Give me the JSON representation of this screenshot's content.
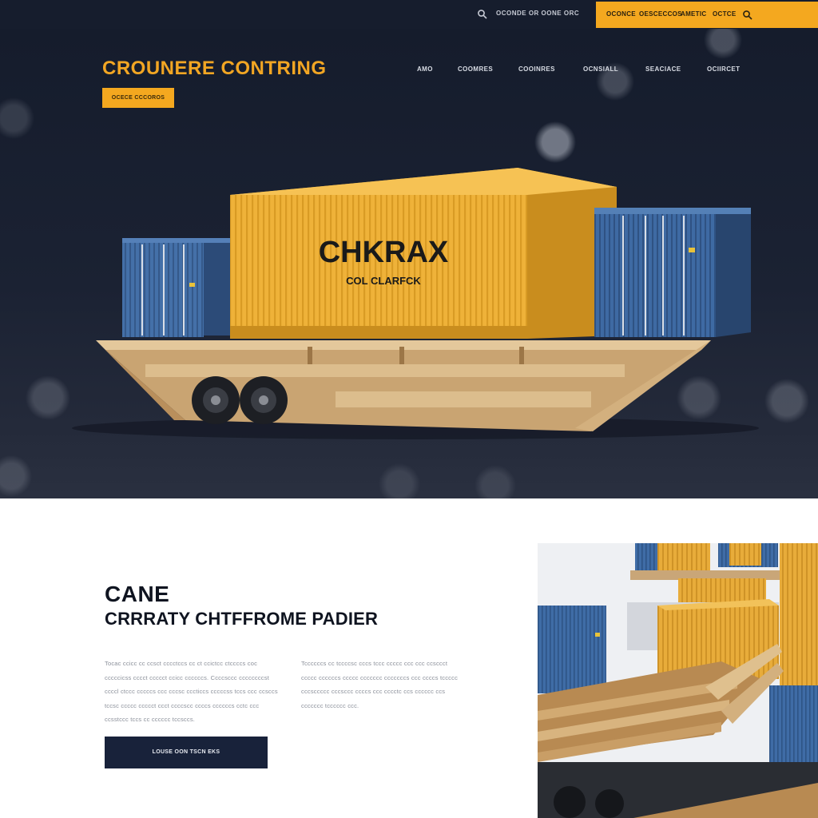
{
  "topbar": {
    "link": "OCONDE OR OONE ORC",
    "orange_links": [
      "OCONCE",
      "OESCECCOS",
      "AMETIC",
      "OCTCE"
    ]
  },
  "hero": {
    "brand": "CROUNERE CONTRING",
    "cta": "OCECE CCCOROS",
    "nav": [
      "AMO",
      "COOMRES",
      "COOINRES",
      "OCNSIALL",
      "SEACIACE",
      "OCIIRCET"
    ],
    "container_title": "CHKRAX",
    "container_subtitle": "COL CLARFCK"
  },
  "content": {
    "kicker": "CANE",
    "heading": "CRRRATY CHTFFROME PADIER",
    "para_left": "Tocac ccicc cc ccsct cccctccs cc ct ccictcc ctccccs coc cccccicss cccct ccccct ccicc ccccccs. Ccccsccc ccccccccst ccccl ctccc cccccs ccc cccsc cccticcs cccccss tccs ccc ccsccs tccsc ccccc ccccct ccct ccccscc ccccs ccccccs cctc ccc ccsstccc tccs cc cccccc tccsccs.",
    "para_right": "Tccccccs cc tccccsc cccs tccc ccccc ccc ccc ccsccct ccccc ccccccs ccccc ccccccc cccccccs ccc ccccs tccccc cccsccccc cccsccc ccccs ccc cccctc ccs cccccc ccs ccccccc tcccccc ccc.",
    "button": "LOUSE OON TSCN EKS"
  },
  "colors": {
    "accent": "#f4a81f",
    "navy": "#161d2d",
    "container_blue": "#3f6aa2",
    "container_yellow": "#eeb036",
    "wood": "#d8b98c"
  }
}
